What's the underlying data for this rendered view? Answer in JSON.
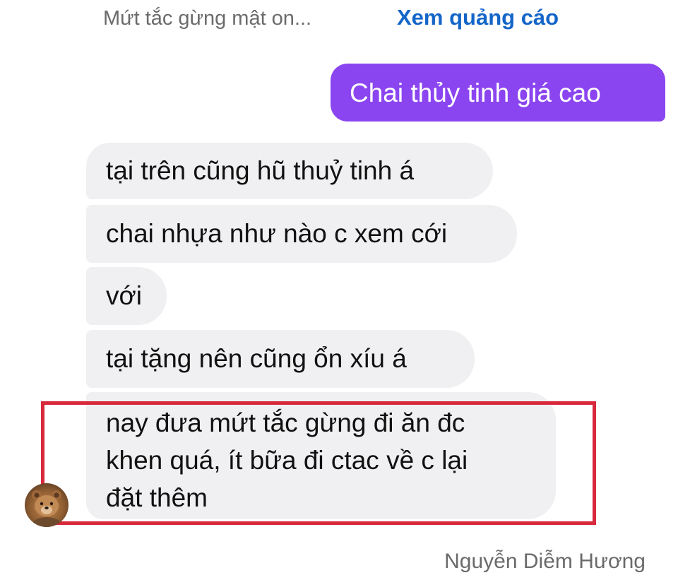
{
  "ad_bar": {
    "product_title": "Mứt tắc gừng mật on...",
    "view_ad_link": "Xem quảng cáo",
    "link_color": "#1465c8"
  },
  "messages": {
    "outgoing": [
      {
        "text": "Chai thủy tinh giá cao",
        "bubble_color": "#8b45f0"
      }
    ],
    "incoming": [
      {
        "text": "tại trên cũng hũ thuỷ tinh á"
      },
      {
        "text": "chai nhựa như nào c xem cới"
      },
      {
        "text": "với"
      },
      {
        "text": "tại tặng nên cũng ổn xíu á"
      },
      {
        "lines": [
          "nay đưa mứt tắc gừng đi ăn đc",
          "khen quá, ít bữa đi ctac về c lại",
          "đặt thêm"
        ]
      }
    ],
    "incoming_bubble_color": "#f0f0f2",
    "highlight_color": "#d8293c"
  },
  "sender_avatar_icon": "bear-avatar-icon",
  "attribution": "Nguyễn Diễm Hương"
}
